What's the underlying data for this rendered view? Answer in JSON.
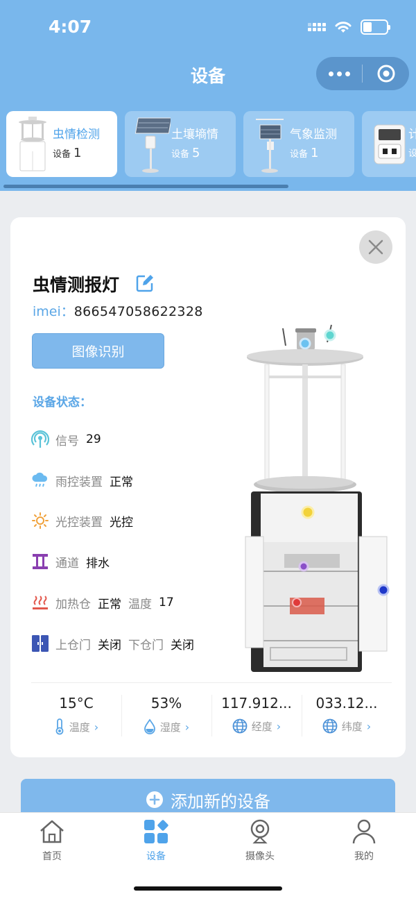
{
  "status_bar": {
    "time": "4:07"
  },
  "header": {
    "title": "设备"
  },
  "categories": [
    {
      "name": "虫情检测",
      "count_label": "设备",
      "count": "1",
      "active": true
    },
    {
      "name": "土壤墒情",
      "count_label": "设备",
      "count": "5",
      "active": false
    },
    {
      "name": "气象监测",
      "count_label": "设备",
      "count": "1",
      "active": false
    },
    {
      "name": "计",
      "count_label": "设",
      "count": "",
      "active": false
    }
  ],
  "device": {
    "name": "虫情测报灯",
    "imei_label": "imei：",
    "imei": "866547058622328",
    "recognize_button": "图像识别",
    "status_title": "设备状态：",
    "signal": {
      "label": "信号",
      "value": "29"
    },
    "rain": {
      "label": "雨控装置",
      "value": "正常"
    },
    "light": {
      "label": "光控装置",
      "value": "光控"
    },
    "channel": {
      "label": "通道",
      "value": "排水"
    },
    "heater": {
      "label": "加热仓",
      "value": "正常",
      "temp_label": "温度",
      "temp_value": "17"
    },
    "door": {
      "upper_label": "上仓门",
      "upper_value": "关闭",
      "lower_label": "下仓门",
      "lower_value": "关闭"
    }
  },
  "stats": [
    {
      "value": "15°C",
      "label": "温度",
      "icon": "thermometer-icon"
    },
    {
      "value": "53%",
      "label": "湿度",
      "icon": "water-drop-icon"
    },
    {
      "value": "117.912...",
      "label": "经度",
      "icon": "globe-icon"
    },
    {
      "value": "033.12...",
      "label": "纬度",
      "icon": "globe-icon"
    }
  ],
  "add_button": "添加新的设备",
  "bottom_nav": [
    {
      "label": "首页",
      "icon": "home-icon",
      "active": false
    },
    {
      "label": "设备",
      "icon": "device-grid-icon",
      "active": true
    },
    {
      "label": "摄像头",
      "icon": "camera-icon",
      "active": false
    },
    {
      "label": "我的",
      "icon": "person-icon",
      "active": false
    }
  ],
  "colors": {
    "primary": "#79b7ec",
    "accent": "#4fa3ea",
    "background": "#ebedf0"
  }
}
